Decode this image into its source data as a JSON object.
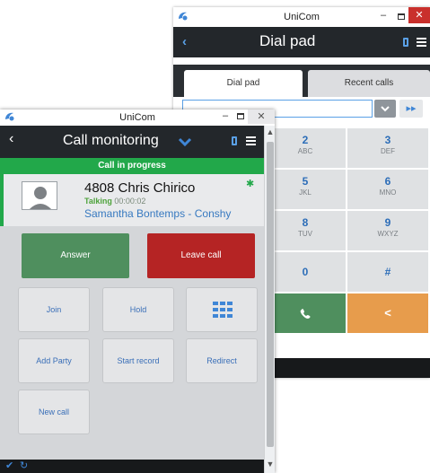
{
  "colors": {
    "accent": "#3f86d6",
    "in_progress": "#22a84a",
    "answer": "#4f8f5e",
    "leave": "#b52424",
    "keypad_bksp": "#e79c4c"
  },
  "dialpad_window": {
    "title": "UniCom",
    "header_title": "Dial pad",
    "tabs": [
      "Dial pad",
      "Recent calls"
    ],
    "input_value": "",
    "keys": [
      {
        "digit": "2",
        "letters": "ABC"
      },
      {
        "digit": "3",
        "letters": "DEF"
      },
      {
        "digit": "5",
        "letters": "JKL"
      },
      {
        "digit": "6",
        "letters": "MNO"
      },
      {
        "digit": "8",
        "letters": "TUV"
      },
      {
        "digit": "9",
        "letters": "WXYZ"
      },
      {
        "digit": "0",
        "letters": ""
      },
      {
        "digit": "#",
        "letters": ""
      }
    ],
    "call_icon": "phone-icon",
    "backspace_glyph": "<"
  },
  "monitor_window": {
    "title": "UniCom",
    "header_title": "Call monitoring",
    "status": "Call in progress",
    "call": {
      "name": "4808 Chris Chirico",
      "state": "Talking",
      "duration": "00:00:02",
      "party": "Samantha Bontemps - Conshy"
    },
    "buttons": {
      "answer": "Answer",
      "leave": "Leave call",
      "join": "Join",
      "hold": "Hold",
      "add_party": "Add Party",
      "start_record": "Start record",
      "redirect": "Redirect",
      "new_call": "New call"
    }
  }
}
